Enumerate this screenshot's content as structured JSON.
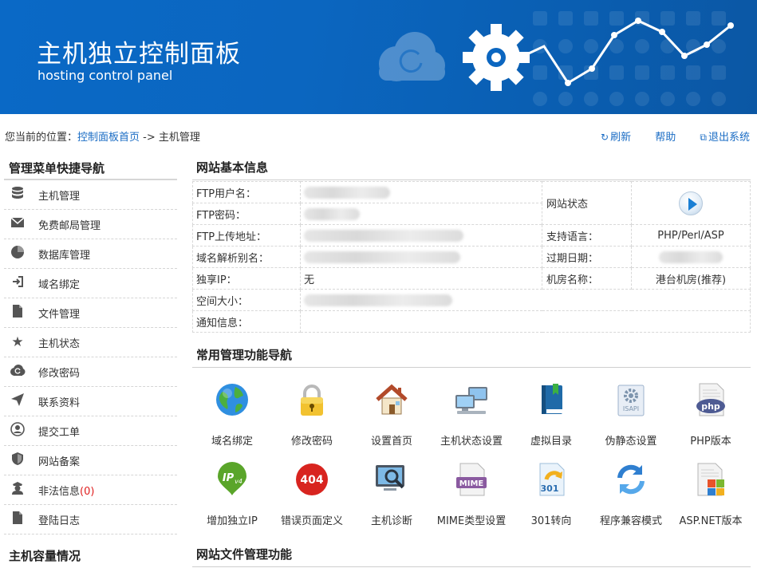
{
  "banner": {
    "title": "主机独立控制面板",
    "subtitle": "hosting control panel"
  },
  "breadcrumb": {
    "prefix": "您当前的位置：",
    "home_link": "控制面板首页",
    "arrow": " -> ",
    "current": "主机管理"
  },
  "toplinks": {
    "refresh_icon": "refresh-icon",
    "refresh": "刷新",
    "help": "帮助",
    "logout_icon": "exit-icon",
    "logout": "退出系统"
  },
  "sidebar": {
    "heading": "管理菜单快捷导航",
    "items": [
      {
        "icon": "database-icon",
        "label": "主机管理"
      },
      {
        "icon": "envelope-icon",
        "label": "免费邮局管理"
      },
      {
        "icon": "pie-chart-icon",
        "label": "数据库管理"
      },
      {
        "icon": "login-arrow-icon",
        "label": "域名绑定"
      },
      {
        "icon": "file-icon",
        "label": "文件管理"
      },
      {
        "icon": "star-icon",
        "label": "主机状态"
      },
      {
        "icon": "cloud-refresh-icon",
        "label": "修改密码"
      },
      {
        "icon": "send-icon",
        "label": "联系资料"
      },
      {
        "icon": "user-circle-icon",
        "label": "提交工单"
      },
      {
        "icon": "shield-icon",
        "label": "网站备案"
      },
      {
        "icon": "officer-icon",
        "label": "非法信息",
        "count_open": "(",
        "count": "0",
        "count_close": ")"
      },
      {
        "icon": "file-icon",
        "label": "登陆日志"
      }
    ],
    "heading2": "主机容量情况"
  },
  "info": {
    "heading": "网站基本信息",
    "ftp_user_label": "FTP用户名：",
    "ftp_pass_label": "FTP密码：",
    "ftp_addr_label": "FTP上传地址：",
    "domain_alias_label": "域名解析别名：",
    "ip_label": "独享IP：",
    "ip_value": "无",
    "space_label": "空间大小：",
    "notice_label": "通知信息：",
    "site_status_label": "网站状态",
    "lang_label": "支持语言：",
    "lang_value": "PHP/Perl/ASP",
    "expire_label": "过期日期：",
    "room_label": "机房名称：",
    "room_value": "港台机房(推荐)"
  },
  "functions": {
    "heading": "常用管理功能导航",
    "rows": [
      [
        {
          "icon": "globe-icon",
          "label": "域名绑定"
        },
        {
          "icon": "padlock-icon",
          "label": "修改密码"
        },
        {
          "icon": "house-icon",
          "label": "设置首页"
        },
        {
          "icon": "computers-icon",
          "label": "主机状态设置"
        },
        {
          "icon": "book-icon",
          "label": "虚拟目录"
        },
        {
          "icon": "isapi-icon",
          "label": "伪静态设置",
          "badge": "ISAPI"
        },
        {
          "icon": "php-file-icon",
          "label": "PHP版本",
          "badge": "php"
        }
      ],
      [
        {
          "icon": "ipv4-icon",
          "label": "增加独立IP",
          "badge": "IP",
          "badge_sub": "v4"
        },
        {
          "icon": "error-404-icon",
          "label": "错误页面定义",
          "badge": "404"
        },
        {
          "icon": "monitor-search-icon",
          "label": "主机诊断"
        },
        {
          "icon": "mime-file-icon",
          "label": "MIME类型设置",
          "badge": "MIME"
        },
        {
          "icon": "redirect-301-icon",
          "label": "301转向",
          "badge": "301"
        },
        {
          "icon": "sync-arrows-icon",
          "label": "程序兼容模式"
        },
        {
          "icon": "aspnet-file-icon",
          "label": "ASP.NET版本"
        }
      ]
    ]
  },
  "files": {
    "heading": "网站文件管理功能"
  },
  "colors": {
    "banner": "#0a66c2",
    "link": "#1a6cc4",
    "warning": "#e02020"
  }
}
